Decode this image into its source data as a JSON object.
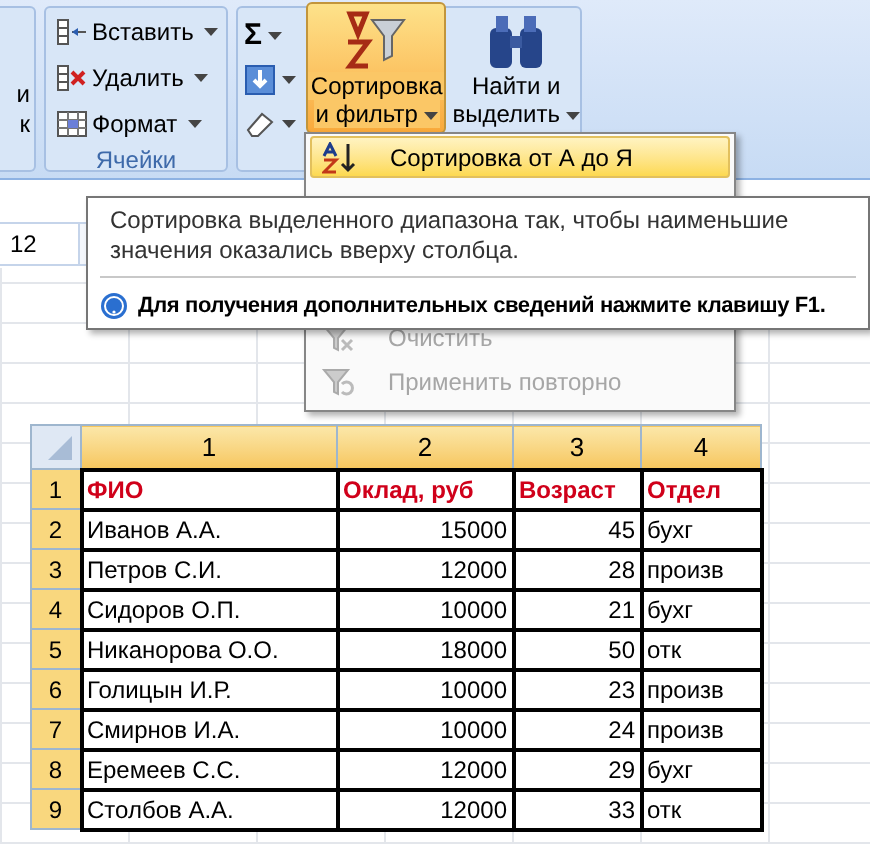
{
  "ribbon": {
    "partial_group": [
      "и",
      "к"
    ],
    "cells_group": {
      "label": "Ячейки",
      "buttons": [
        {
          "kind": "insert",
          "label": "Вставить"
        },
        {
          "kind": "delete",
          "label": "Удалить"
        },
        {
          "kind": "format",
          "label": "Формат"
        }
      ]
    },
    "editing_group": {
      "small_buttons": [
        {
          "kind": "sum",
          "label": "Σ"
        },
        {
          "kind": "fill"
        },
        {
          "kind": "clear"
        }
      ],
      "sort_button": {
        "lines": [
          "Сортировка",
          "и фильтр"
        ],
        "selected": true
      },
      "find_button": {
        "lines": [
          "Найти и",
          "выделить"
        ]
      }
    }
  },
  "name_box": {
    "value": "12"
  },
  "sort_menu": {
    "items": [
      {
        "kind": "sort_az",
        "label": "Сортировка от А до Я",
        "selected": true,
        "disabled": false
      },
      {
        "kind": "clear",
        "label": "Очистить",
        "selected": false,
        "disabled": true
      },
      {
        "kind": "reapply",
        "label": "Применить повторно",
        "selected": false,
        "disabled": true
      }
    ]
  },
  "tooltip": {
    "description": "Сортировка выделенного диапазона так, чтобы наименьшие значения оказались вверху столбца.",
    "help": "Для получения дополнительных сведений нажмите клавишу F1."
  },
  "sheet": {
    "columns": [
      {
        "label": "1",
        "selected": true
      },
      {
        "label": "2",
        "selected": true
      },
      {
        "label": "3",
        "selected": true
      },
      {
        "label": "4",
        "selected": true
      }
    ],
    "rows": [
      {
        "label": "1",
        "selected": true,
        "kind": "header",
        "cells": [
          "ФИО",
          "Оклад, руб",
          "Возраст",
          "Отдел"
        ]
      },
      {
        "label": "2",
        "selected": true,
        "kind": "data",
        "cells": [
          "Иванов А.А.",
          "15000",
          "45",
          "бухг"
        ]
      },
      {
        "label": "3",
        "selected": true,
        "kind": "data",
        "cells": [
          "Петров С.И.",
          "12000",
          "28",
          "произв"
        ]
      },
      {
        "label": "4",
        "selected": true,
        "kind": "data",
        "cells": [
          "Сидоров О.П.",
          "10000",
          "21",
          "бухг"
        ]
      },
      {
        "label": "5",
        "selected": true,
        "kind": "data",
        "cells": [
          "Никанорова О.О.",
          "18000",
          "50",
          "отк"
        ]
      },
      {
        "label": "6",
        "selected": true,
        "kind": "data",
        "cells": [
          "Голицын И.Р.",
          "10000",
          "23",
          "произв"
        ]
      },
      {
        "label": "7",
        "selected": true,
        "kind": "data",
        "cells": [
          "Смирнов И.А.",
          "10000",
          "24",
          "произв"
        ]
      },
      {
        "label": "8",
        "selected": true,
        "kind": "data",
        "cells": [
          "Еремеев С.С.",
          "12000",
          "29",
          "бухг"
        ]
      },
      {
        "label": "9",
        "selected": true,
        "kind": "data",
        "cells": [
          "Столбов А.А.",
          "12000",
          "33",
          "отк"
        ]
      }
    ]
  }
}
